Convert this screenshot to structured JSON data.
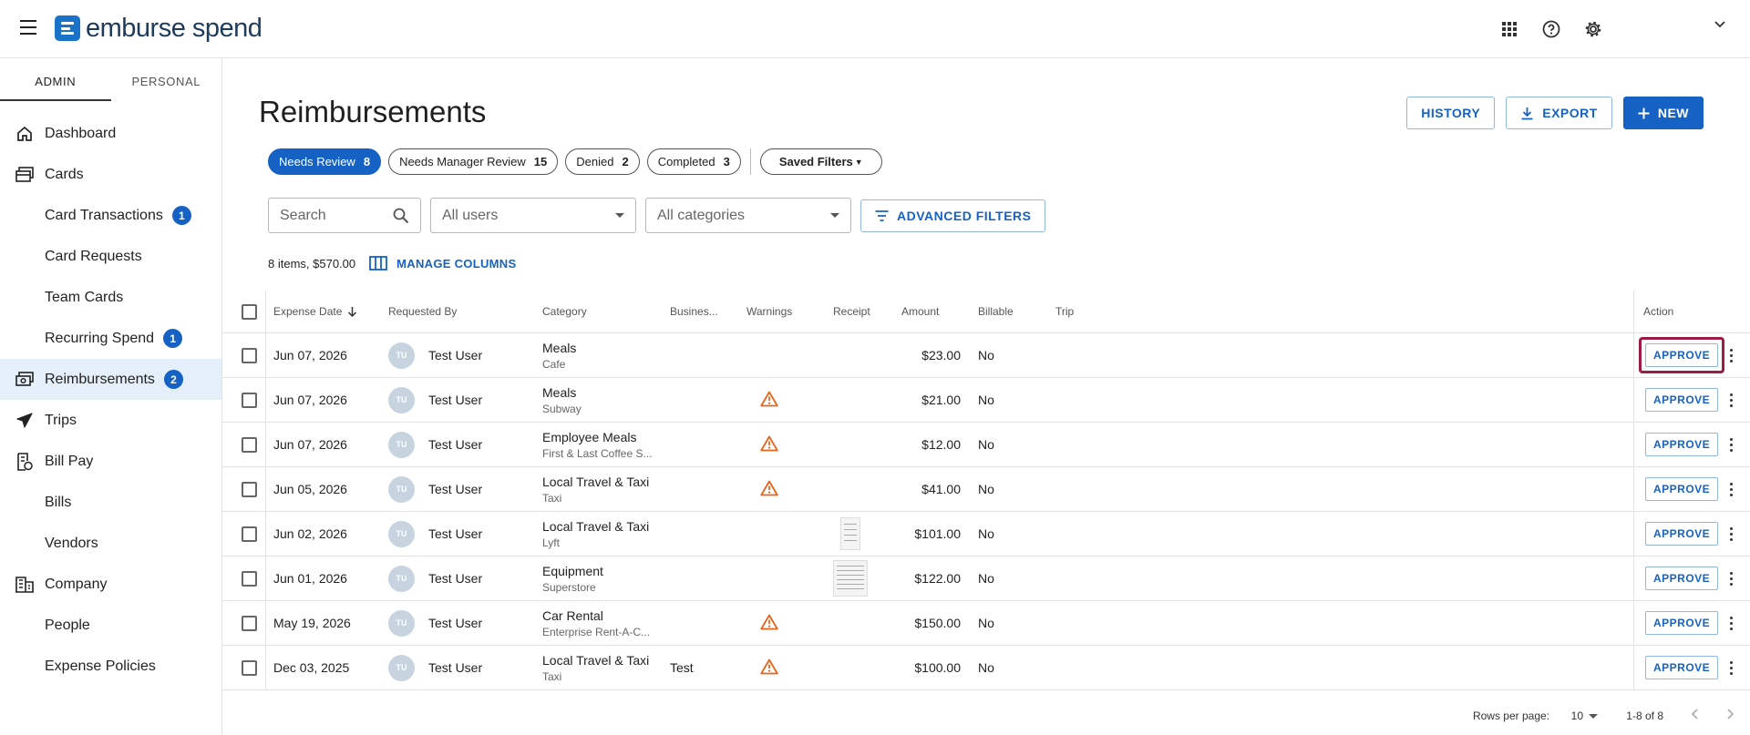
{
  "app": {
    "logo_text": "emburse spend"
  },
  "topbar": {
    "icons": [
      "apps-grid-icon",
      "help-icon",
      "gear-icon",
      "chevron-down-icon"
    ]
  },
  "sidebar": {
    "tabs": [
      "ADMIN",
      "PERSONAL"
    ],
    "items": [
      {
        "label": "Dashboard",
        "icon": "home-icon",
        "sub": false
      },
      {
        "label": "Cards",
        "icon": "cards-icon",
        "sub": false
      },
      {
        "label": "Card Transactions",
        "sub": true,
        "badge": "1"
      },
      {
        "label": "Card Requests",
        "sub": true
      },
      {
        "label": "Team Cards",
        "sub": true
      },
      {
        "label": "Recurring Spend",
        "sub": true,
        "badge": "1"
      },
      {
        "label": "Reimbursements",
        "icon": "money-icon",
        "sub": false,
        "badge": "2",
        "active": true
      },
      {
        "label": "Trips",
        "icon": "airplane-icon",
        "sub": false
      },
      {
        "label": "Bill Pay",
        "icon": "bill-icon",
        "sub": false
      },
      {
        "label": "Bills",
        "sub": true
      },
      {
        "label": "Vendors",
        "sub": true
      },
      {
        "label": "Company",
        "icon": "building-icon",
        "sub": false
      },
      {
        "label": "People",
        "sub": true
      },
      {
        "label": "Expense Policies",
        "sub": true
      }
    ]
  },
  "main": {
    "title": "Reimbursements",
    "buttons": {
      "history": "HISTORY",
      "export": "EXPORT",
      "new": "NEW"
    },
    "pills": [
      {
        "label": "Needs Review",
        "count": "8",
        "active": true
      },
      {
        "label": "Needs Manager Review",
        "count": "15"
      },
      {
        "label": "Denied",
        "count": "2"
      },
      {
        "label": "Completed",
        "count": "3"
      }
    ],
    "saved_filters": "Saved Filters",
    "search_placeholder": "Search",
    "users_select": "All users",
    "categories_select": "All categories",
    "advanced_filters": "ADVANCED FILTERS",
    "summary": "8 items, $570.00",
    "manage_columns": "MANAGE COLUMNS"
  },
  "table": {
    "headers": [
      "Expense Date",
      "Requested By",
      "Category",
      "Busines...",
      "Warnings",
      "Receipt",
      "Amount",
      "Billable",
      "Trip",
      "Action"
    ],
    "approve_label": "APPROVE",
    "rows": [
      {
        "date": "Jun 07, 2026",
        "initials": "TU",
        "user": "Test User",
        "category": "Meals",
        "merchant": "Cafe",
        "business": "",
        "warning": false,
        "receipt": "",
        "amount": "$23.00",
        "billable": "No",
        "highlight": true
      },
      {
        "date": "Jun 07, 2026",
        "initials": "TU",
        "user": "Test User",
        "category": "Meals",
        "merchant": "Subway",
        "business": "",
        "warning": true,
        "receipt": "",
        "amount": "$21.00",
        "billable": "No"
      },
      {
        "date": "Jun 07, 2026",
        "initials": "TU",
        "user": "Test User",
        "category": "Employee Meals",
        "merchant": "First & Last Coffee S...",
        "business": "",
        "warning": true,
        "receipt": "",
        "amount": "$12.00",
        "billable": "No"
      },
      {
        "date": "Jun 05, 2026",
        "initials": "TU",
        "user": "Test User",
        "category": "Local Travel & Taxi",
        "merchant": "Taxi",
        "business": "",
        "warning": true,
        "receipt": "",
        "amount": "$41.00",
        "billable": "No"
      },
      {
        "date": "Jun 02, 2026",
        "initials": "TU",
        "user": "Test User",
        "category": "Local Travel & Taxi",
        "merchant": "Lyft",
        "business": "",
        "warning": false,
        "receipt": "narrow",
        "amount": "$101.00",
        "billable": "No"
      },
      {
        "date": "Jun 01, 2026",
        "initials": "TU",
        "user": "Test User",
        "category": "Equipment",
        "merchant": "Superstore",
        "business": "",
        "warning": false,
        "receipt": "wide",
        "amount": "$122.00",
        "billable": "No"
      },
      {
        "date": "May 19, 2026",
        "initials": "TU",
        "user": "Test User",
        "category": "Car Rental",
        "merchant": "Enterprise Rent-A-C...",
        "business": "",
        "warning": true,
        "receipt": "",
        "amount": "$150.00",
        "billable": "No"
      },
      {
        "date": "Dec 03, 2025",
        "initials": "TU",
        "user": "Test User",
        "category": "Local Travel & Taxi",
        "merchant": "Taxi",
        "business": "Test",
        "warning": true,
        "receipt": "",
        "amount": "$100.00",
        "billable": "No"
      }
    ]
  },
  "pager": {
    "rows_per_page_label": "Rows per page:",
    "rows_per_page": "10",
    "range": "1-8 of 8"
  },
  "colors": {
    "accent": "#1662c4",
    "highlight": "#9c1c44",
    "warning": "#e8641a"
  }
}
